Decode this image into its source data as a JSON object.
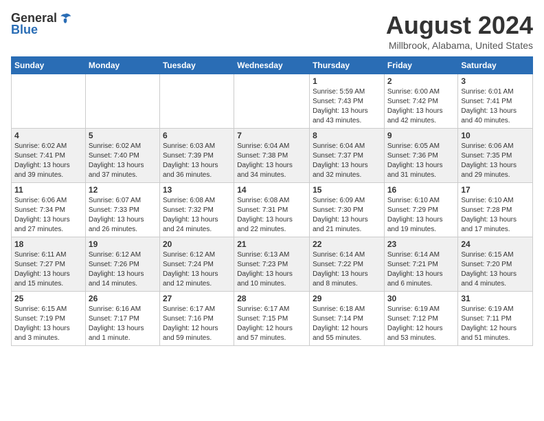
{
  "header": {
    "logo_general": "General",
    "logo_blue": "Blue",
    "month_year": "August 2024",
    "location": "Millbrook, Alabama, United States"
  },
  "calendar": {
    "headers": [
      "Sunday",
      "Monday",
      "Tuesday",
      "Wednesday",
      "Thursday",
      "Friday",
      "Saturday"
    ],
    "rows": [
      [
        {
          "day": "",
          "info": ""
        },
        {
          "day": "",
          "info": ""
        },
        {
          "day": "",
          "info": ""
        },
        {
          "day": "",
          "info": ""
        },
        {
          "day": "1",
          "info": "Sunrise: 5:59 AM\nSunset: 7:43 PM\nDaylight: 13 hours\nand 43 minutes."
        },
        {
          "day": "2",
          "info": "Sunrise: 6:00 AM\nSunset: 7:42 PM\nDaylight: 13 hours\nand 42 minutes."
        },
        {
          "day": "3",
          "info": "Sunrise: 6:01 AM\nSunset: 7:41 PM\nDaylight: 13 hours\nand 40 minutes."
        }
      ],
      [
        {
          "day": "4",
          "info": "Sunrise: 6:02 AM\nSunset: 7:41 PM\nDaylight: 13 hours\nand 39 minutes."
        },
        {
          "day": "5",
          "info": "Sunrise: 6:02 AM\nSunset: 7:40 PM\nDaylight: 13 hours\nand 37 minutes."
        },
        {
          "day": "6",
          "info": "Sunrise: 6:03 AM\nSunset: 7:39 PM\nDaylight: 13 hours\nand 36 minutes."
        },
        {
          "day": "7",
          "info": "Sunrise: 6:04 AM\nSunset: 7:38 PM\nDaylight: 13 hours\nand 34 minutes."
        },
        {
          "day": "8",
          "info": "Sunrise: 6:04 AM\nSunset: 7:37 PM\nDaylight: 13 hours\nand 32 minutes."
        },
        {
          "day": "9",
          "info": "Sunrise: 6:05 AM\nSunset: 7:36 PM\nDaylight: 13 hours\nand 31 minutes."
        },
        {
          "day": "10",
          "info": "Sunrise: 6:06 AM\nSunset: 7:35 PM\nDaylight: 13 hours\nand 29 minutes."
        }
      ],
      [
        {
          "day": "11",
          "info": "Sunrise: 6:06 AM\nSunset: 7:34 PM\nDaylight: 13 hours\nand 27 minutes."
        },
        {
          "day": "12",
          "info": "Sunrise: 6:07 AM\nSunset: 7:33 PM\nDaylight: 13 hours\nand 26 minutes."
        },
        {
          "day": "13",
          "info": "Sunrise: 6:08 AM\nSunset: 7:32 PM\nDaylight: 13 hours\nand 24 minutes."
        },
        {
          "day": "14",
          "info": "Sunrise: 6:08 AM\nSunset: 7:31 PM\nDaylight: 13 hours\nand 22 minutes."
        },
        {
          "day": "15",
          "info": "Sunrise: 6:09 AM\nSunset: 7:30 PM\nDaylight: 13 hours\nand 21 minutes."
        },
        {
          "day": "16",
          "info": "Sunrise: 6:10 AM\nSunset: 7:29 PM\nDaylight: 13 hours\nand 19 minutes."
        },
        {
          "day": "17",
          "info": "Sunrise: 6:10 AM\nSunset: 7:28 PM\nDaylight: 13 hours\nand 17 minutes."
        }
      ],
      [
        {
          "day": "18",
          "info": "Sunrise: 6:11 AM\nSunset: 7:27 PM\nDaylight: 13 hours\nand 15 minutes."
        },
        {
          "day": "19",
          "info": "Sunrise: 6:12 AM\nSunset: 7:26 PM\nDaylight: 13 hours\nand 14 minutes."
        },
        {
          "day": "20",
          "info": "Sunrise: 6:12 AM\nSunset: 7:24 PM\nDaylight: 13 hours\nand 12 minutes."
        },
        {
          "day": "21",
          "info": "Sunrise: 6:13 AM\nSunset: 7:23 PM\nDaylight: 13 hours\nand 10 minutes."
        },
        {
          "day": "22",
          "info": "Sunrise: 6:14 AM\nSunset: 7:22 PM\nDaylight: 13 hours\nand 8 minutes."
        },
        {
          "day": "23",
          "info": "Sunrise: 6:14 AM\nSunset: 7:21 PM\nDaylight: 13 hours\nand 6 minutes."
        },
        {
          "day": "24",
          "info": "Sunrise: 6:15 AM\nSunset: 7:20 PM\nDaylight: 13 hours\nand 4 minutes."
        }
      ],
      [
        {
          "day": "25",
          "info": "Sunrise: 6:15 AM\nSunset: 7:19 PM\nDaylight: 13 hours\nand 3 minutes."
        },
        {
          "day": "26",
          "info": "Sunrise: 6:16 AM\nSunset: 7:17 PM\nDaylight: 13 hours\nand 1 minute."
        },
        {
          "day": "27",
          "info": "Sunrise: 6:17 AM\nSunset: 7:16 PM\nDaylight: 12 hours\nand 59 minutes."
        },
        {
          "day": "28",
          "info": "Sunrise: 6:17 AM\nSunset: 7:15 PM\nDaylight: 12 hours\nand 57 minutes."
        },
        {
          "day": "29",
          "info": "Sunrise: 6:18 AM\nSunset: 7:14 PM\nDaylight: 12 hours\nand 55 minutes."
        },
        {
          "day": "30",
          "info": "Sunrise: 6:19 AM\nSunset: 7:12 PM\nDaylight: 12 hours\nand 53 minutes."
        },
        {
          "day": "31",
          "info": "Sunrise: 6:19 AM\nSunset: 7:11 PM\nDaylight: 12 hours\nand 51 minutes."
        }
      ]
    ]
  }
}
